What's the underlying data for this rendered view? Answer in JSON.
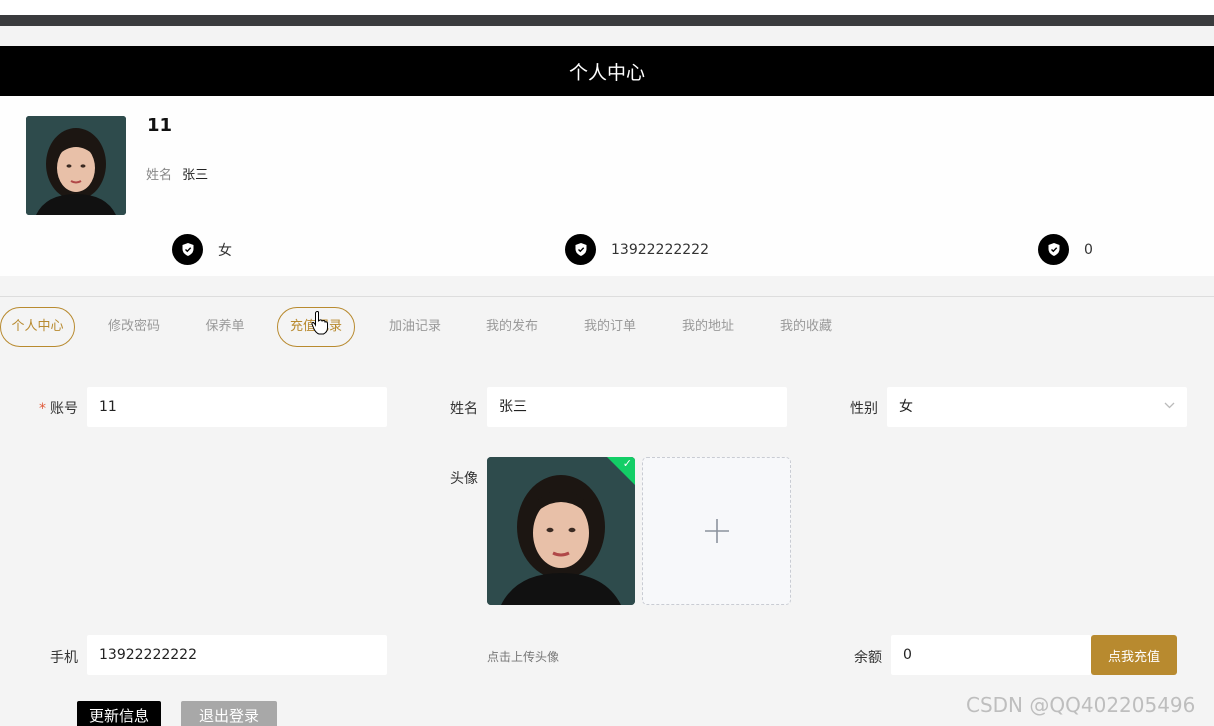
{
  "header": {
    "title": "个人中心"
  },
  "profile": {
    "username": "11",
    "name_label": "姓名",
    "name_value": "张三",
    "stats": [
      {
        "value": "女",
        "icon": "shield-icon"
      },
      {
        "value": "13922222222",
        "icon": "shield-icon"
      },
      {
        "value": "0",
        "icon": "shield-icon"
      }
    ]
  },
  "tabs": [
    {
      "label": "个人中心",
      "active": true
    },
    {
      "label": "修改密码"
    },
    {
      "label": "保养单"
    },
    {
      "label": "充值记录",
      "hovered": true
    },
    {
      "label": "加油记录"
    },
    {
      "label": "我的发布"
    },
    {
      "label": "我的订单"
    },
    {
      "label": "我的地址"
    },
    {
      "label": "我的收藏"
    }
  ],
  "form": {
    "account_label": "账号",
    "account_value": "11",
    "name_label": "姓名",
    "name_value": "张三",
    "gender_label": "性别",
    "gender_value": "女",
    "avatar_label": "头像",
    "upload_tip": "点击上传头像",
    "phone_label": "手机",
    "phone_value": "13922222222",
    "balance_label": "余额",
    "balance_value": "0",
    "recharge_button": "点我充值",
    "update_button": "更新信息",
    "logout_button": "退出登录"
  },
  "watermark": "CSDN @QQ402205496",
  "colors": {
    "accent": "#b88a2f",
    "header_bg": "#000000",
    "success": "#13ce66"
  }
}
